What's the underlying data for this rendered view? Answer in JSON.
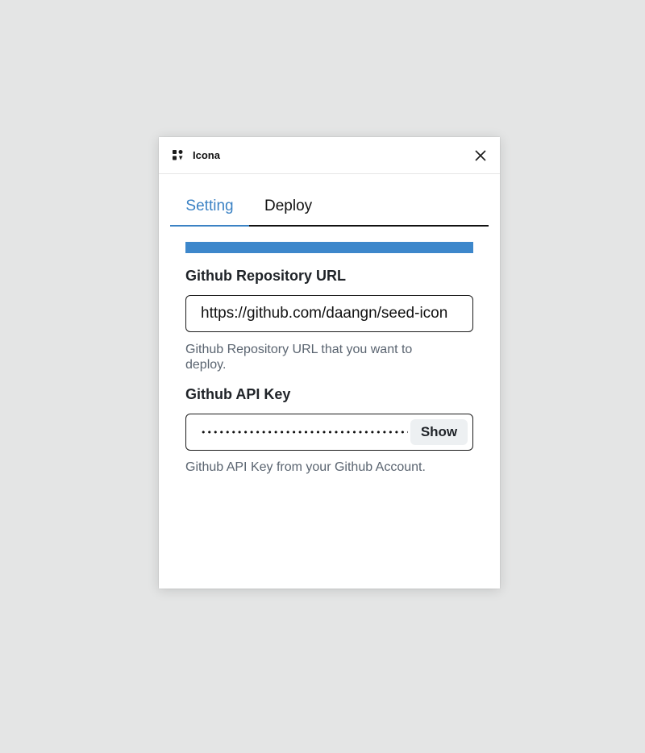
{
  "app": {
    "title": "Icona",
    "close_label": "Close"
  },
  "tabs": [
    {
      "label": "Setting",
      "active": true
    },
    {
      "label": "Deploy",
      "active": false
    }
  ],
  "progress": {
    "value": 1.0,
    "color": "#3d87cb"
  },
  "fields": {
    "repo_url": {
      "label": "Github Repository URL",
      "value": "https://github.com/daangn/seed-icon",
      "helper": "Github Repository URL that you want to deploy."
    },
    "api_key": {
      "label": "Github API Key",
      "value": "••••••••••••••••••••••••••••••••••••••••",
      "show_button": "Show",
      "helper": "Github API Key from your Github Account."
    }
  },
  "colors": {
    "accent": "#3b82c4",
    "background": "#e4e5e5",
    "panel": "#ffffff"
  },
  "icons": {
    "app": "grid-icon",
    "close": "close-icon"
  }
}
